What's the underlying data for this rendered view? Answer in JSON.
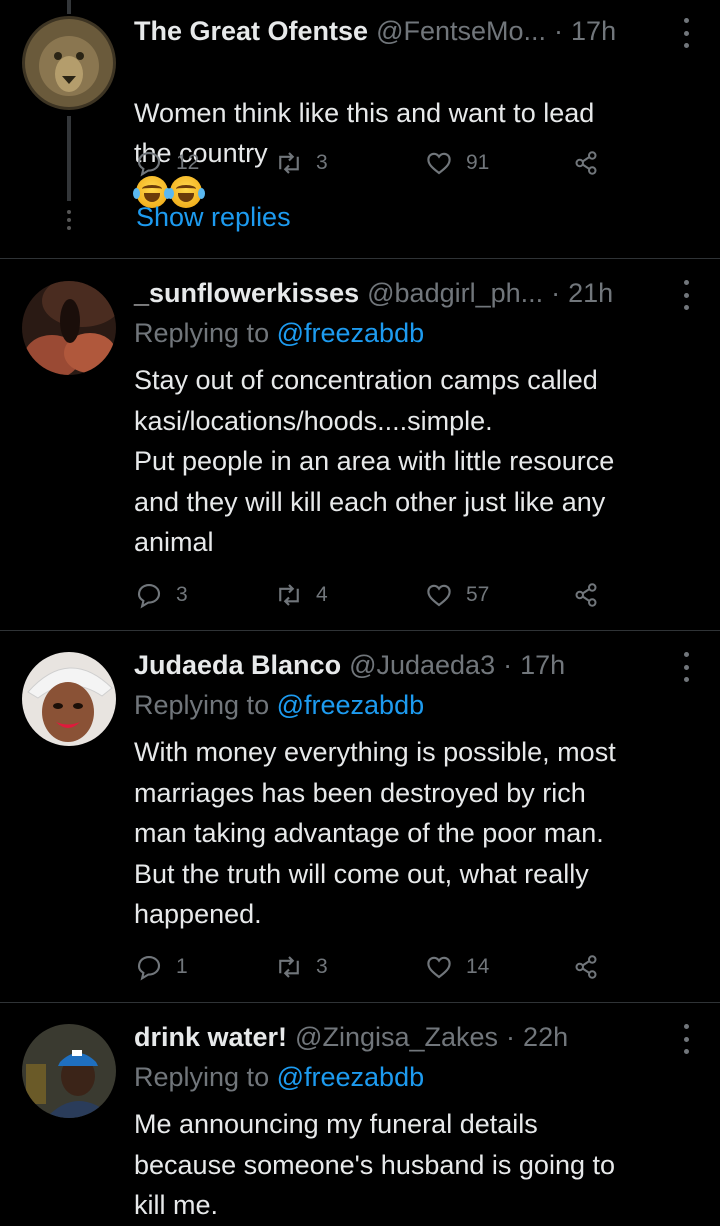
{
  "tweets": [
    {
      "name": "The Great Ofentse",
      "handle": "@FentseMo...",
      "time": "17h",
      "text": "Women think like this and want to lead\nthe country",
      "emoji": [
        "face-with-tears-of-joy-emoji",
        "face-with-tears-of-joy-emoji"
      ],
      "replies": "12",
      "retweets": "3",
      "likes": "91",
      "show_replies": "Show replies"
    },
    {
      "name": "_sunflowerkisses",
      "handle": "@badgirl_ph...",
      "time": "21h",
      "replying_prefix": "Replying to",
      "replying_to": "@freezabdb",
      "text": "Stay out of concentration camps called\nkasi/locations/hoods....simple.\nPut people in an area with little resource\nand they will kill each other just like any\nanimal",
      "replies": "3",
      "retweets": "4",
      "likes": "57"
    },
    {
      "name": "Judaeda Blanco",
      "handle": "@Judaeda3",
      "time": "17h",
      "replying_prefix": "Replying to",
      "replying_to": "@freezabdb",
      "text": "With money everything is possible, most\nmarriages has been destroyed by rich\nman taking advantage of the poor man.\nBut the truth will come out, what really\nhappened.",
      "replies": "1",
      "retweets": "3",
      "likes": "14"
    },
    {
      "name": "drink water!",
      "handle": "@Zingisa_Zakes",
      "time": "22h",
      "replying_prefix": "Replying to",
      "replying_to": "@freezabdb",
      "text": "Me announcing my funeral details\nbecause someone's husband is going to\nkill me."
    }
  ],
  "separator": "·",
  "colors": {
    "background": "#000000",
    "text": "#e7e9ea",
    "muted": "#71767b",
    "link": "#1d9bf0",
    "divider": "#2f3336"
  }
}
